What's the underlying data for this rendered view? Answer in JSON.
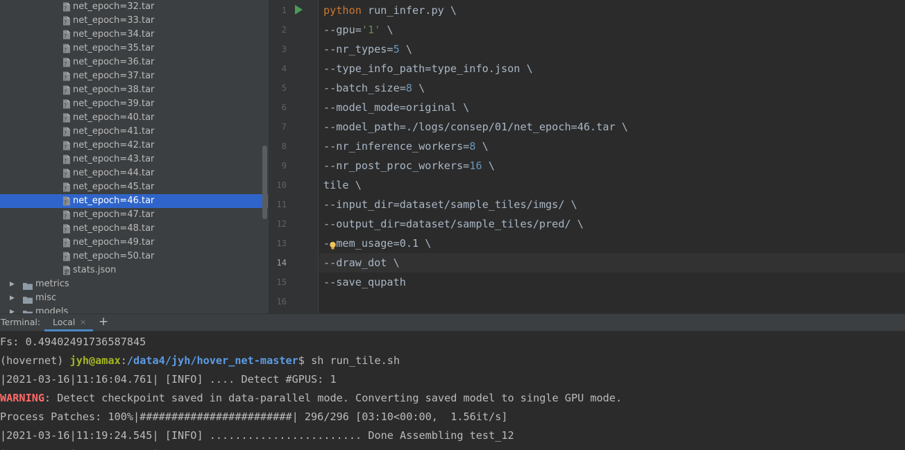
{
  "tree": {
    "files": [
      "net_epoch=32.tar",
      "net_epoch=33.tar",
      "net_epoch=34.tar",
      "net_epoch=35.tar",
      "net_epoch=36.tar",
      "net_epoch=37.tar",
      "net_epoch=38.tar",
      "net_epoch=39.tar",
      "net_epoch=40.tar",
      "net_epoch=41.tar",
      "net_epoch=42.tar",
      "net_epoch=43.tar",
      "net_epoch=44.tar",
      "net_epoch=45.tar",
      "net_epoch=46.tar",
      "net_epoch=47.tar",
      "net_epoch=48.tar",
      "net_epoch=49.tar",
      "net_epoch=50.tar",
      "stats.json"
    ],
    "selected_file": "net_epoch=46.tar",
    "folders": [
      "metrics",
      "misc",
      "models"
    ]
  },
  "editor": {
    "line_numbers": [
      "1",
      "2",
      "3",
      "4",
      "5",
      "6",
      "7",
      "8",
      "9",
      "10",
      "11",
      "12",
      "13",
      "14",
      "15",
      "16"
    ],
    "current_line": "14",
    "lines": [
      {
        "text": "python run_infer.py \\",
        "parts": [
          {
            "t": "python",
            "c": "kw"
          },
          {
            "t": " run_infer.py \\",
            "c": ""
          }
        ]
      },
      {
        "parts": [
          {
            "t": "--gpu=",
            "c": ""
          },
          {
            "t": "'1'",
            "c": "str"
          },
          {
            "t": " \\",
            "c": ""
          }
        ]
      },
      {
        "parts": [
          {
            "t": "--nr_types=",
            "c": ""
          },
          {
            "t": "5",
            "c": "num"
          },
          {
            "t": " \\",
            "c": ""
          }
        ]
      },
      {
        "parts": [
          {
            "t": "--type_info_path=type_info.json \\",
            "c": ""
          }
        ]
      },
      {
        "parts": [
          {
            "t": "--batch_size=",
            "c": ""
          },
          {
            "t": "8",
            "c": "num"
          },
          {
            "t": " \\",
            "c": ""
          }
        ]
      },
      {
        "parts": [
          {
            "t": "--model_mode=original \\",
            "c": ""
          }
        ]
      },
      {
        "parts": [
          {
            "t": "--model_path=./logs/consep/01/net_epoch=46.tar \\",
            "c": ""
          }
        ]
      },
      {
        "parts": [
          {
            "t": "--nr_inference_workers=",
            "c": ""
          },
          {
            "t": "8",
            "c": "num"
          },
          {
            "t": " \\",
            "c": ""
          }
        ]
      },
      {
        "parts": [
          {
            "t": "--nr_post_proc_workers=",
            "c": ""
          },
          {
            "t": "16",
            "c": "num"
          },
          {
            "t": " \\",
            "c": ""
          }
        ]
      },
      {
        "parts": [
          {
            "t": "tile \\",
            "c": ""
          }
        ]
      },
      {
        "parts": [
          {
            "t": "--input_dir=dataset/sample_tiles/imgs/ \\",
            "c": ""
          }
        ]
      },
      {
        "parts": [
          {
            "t": "--output_dir=dataset/sample_tiles/pred/ \\",
            "c": ""
          }
        ]
      },
      {
        "parts": [
          {
            "t": "--mem_usage=0.1 \\",
            "c": ""
          }
        ]
      },
      {
        "parts": [
          {
            "t": "--draw_dot \\",
            "c": ""
          }
        ]
      },
      {
        "parts": [
          {
            "t": "--save_qupath",
            "c": ""
          }
        ]
      },
      {
        "parts": []
      }
    ]
  },
  "terminal": {
    "title": "Terminal:",
    "tab_label": "Local",
    "close_glyph": "×",
    "add_glyph": "+",
    "fs_line": "Fs: 0.49402491736587845",
    "prompt_env": "(hovernet) ",
    "prompt_user": "jyh@amax",
    "prompt_sep": ":",
    "prompt_path": "/data4/jyh/hover_net-master",
    "prompt_cmd": "$ sh run_tile.sh",
    "info_line_1": "|2021-03-16|11:16:04.761| [INFO] .... Detect #GPUS: 1",
    "warning_label": "WARNING",
    "warning_text": ": Detect checkpoint saved in data-parallel mode. Converting saved model to single GPU mode.",
    "progress_line": "Process Patches: 100%|########################| 296/296 [03:10<00:00,  1.56it/s]",
    "info_line_2": "|2021-03-16|11:19:24.545| [INFO] ........................ Done Assembling test_12",
    "info_line_3": "|          |            |"
  },
  "colors": {
    "selection": "#2f65ca",
    "keyword": "#cc7832",
    "number": "#6897bb",
    "string": "#6a8759",
    "user": "#a6b722",
    "path": "#5c9ce6",
    "warning": "#ff6b68"
  }
}
